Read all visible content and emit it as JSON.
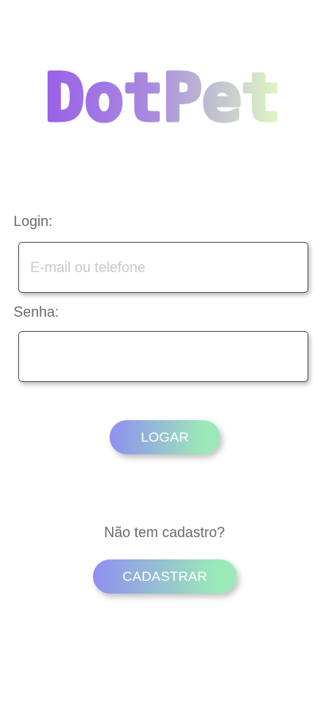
{
  "app": {
    "logo_text": "DotPet"
  },
  "login": {
    "label": "Login:",
    "placeholder": "E-mail ou telefone",
    "value": ""
  },
  "password": {
    "label": "Senha:",
    "value": ""
  },
  "buttons": {
    "login_label": "LOGAR",
    "register_label": "CADASTRAR"
  },
  "register_prompt": "Não tem cadastro?",
  "colors": {
    "logo_gradient": [
      "#9a63e8",
      "#b7a6de",
      "#dcf3c2"
    ],
    "button_gradient": [
      "#8f8ff0",
      "#9be8b8"
    ],
    "label_text": "#6b6b6b",
    "placeholder": "#c9c9c9"
  }
}
